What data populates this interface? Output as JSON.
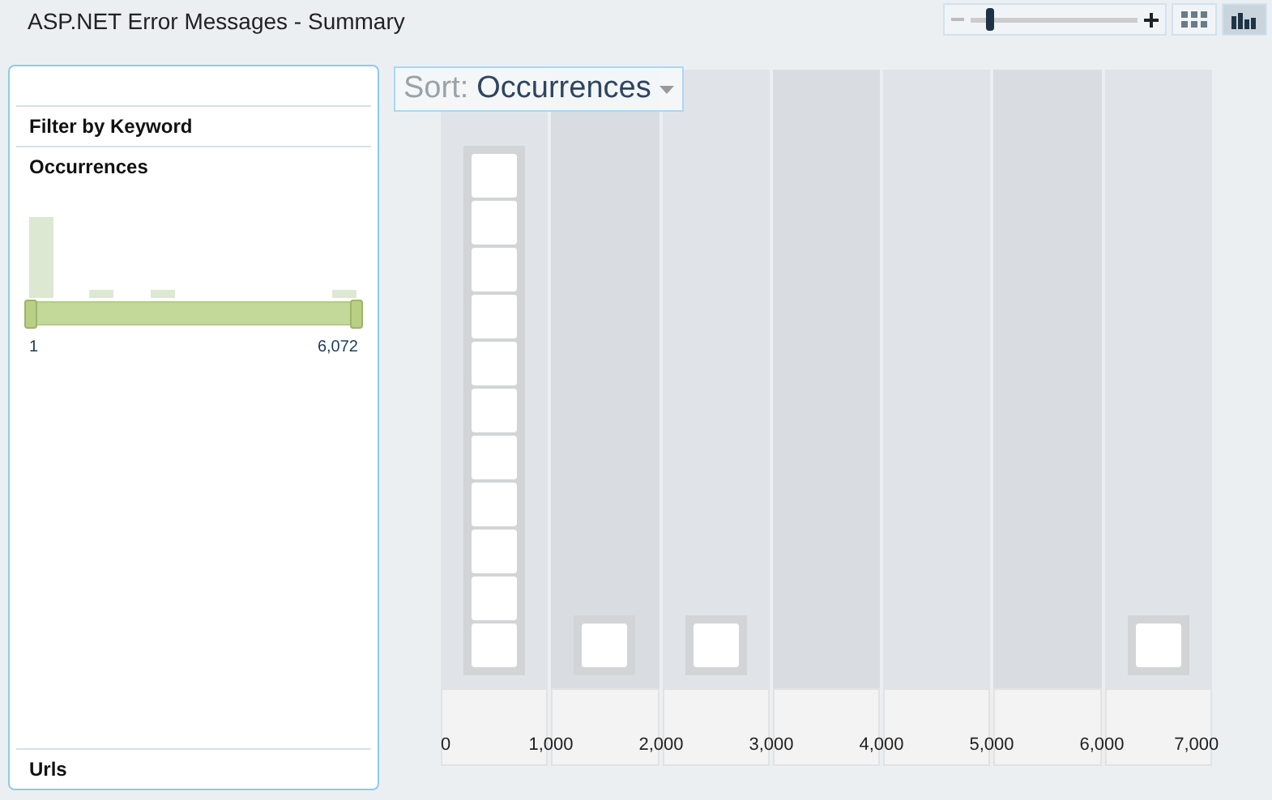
{
  "window": {
    "title": "ASP.NET Error Messages - Summary"
  },
  "zoom_slider": {
    "level": 0.12
  },
  "view_buttons": [
    {
      "kind": "grid",
      "selected": false
    },
    {
      "kind": "bars",
      "selected": true
    }
  ],
  "sidebar": {
    "sections": [
      {
        "title": "Filter by Keyword",
        "kind": "keyword"
      },
      {
        "title": "Occurrences",
        "kind": "range",
        "min_label": "1",
        "max_label": "6,072",
        "low_thumb": {
          "level": 0
        },
        "high_thumb": {
          "level": 1
        }
      }
    ],
    "footer_title": "Urls"
  },
  "sort": {
    "label": "Sort:",
    "value": "Occurrences"
  },
  "bins": [
    {
      "cards": [
        {
          "kind": "item"
        },
        {
          "kind": "item"
        },
        {
          "kind": "item"
        },
        {
          "kind": "item"
        },
        {
          "kind": "item"
        },
        {
          "kind": "item"
        },
        {
          "kind": "item"
        },
        {
          "kind": "item"
        },
        {
          "kind": "item"
        },
        {
          "kind": "item"
        },
        {
          "kind": "item"
        }
      ]
    },
    {
      "cards": [
        {
          "kind": "item"
        }
      ]
    },
    {
      "cards": [
        {
          "kind": "item"
        }
      ]
    },
    {
      "kind": "empty"
    },
    {
      "kind": "empty"
    },
    {
      "kind": "empty"
    },
    {
      "cards": [
        {
          "kind": "item"
        }
      ]
    }
  ],
  "axis_labels": [
    "0",
    "1,000",
    "2,000",
    "3,000",
    "4,000",
    "5,000",
    "6,000",
    "7,000"
  ]
}
